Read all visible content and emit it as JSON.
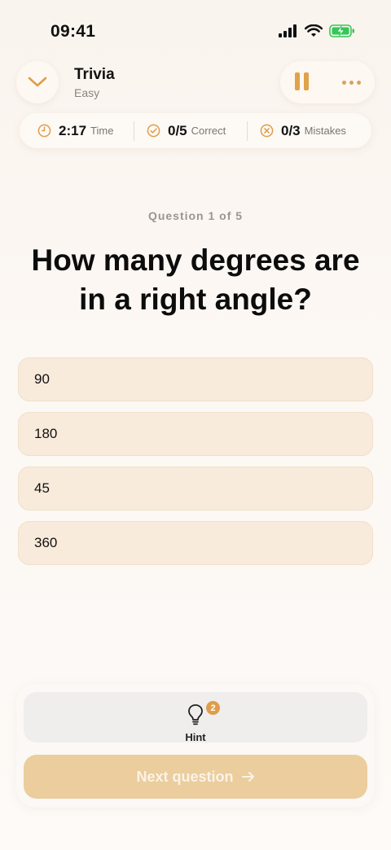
{
  "status_bar": {
    "time": "09:41",
    "battery_color": "#34c759"
  },
  "header": {
    "title": "Trivia",
    "subtitle": "Easy",
    "collapse_icon": "chevron-down-icon",
    "pause_icon": "pause-icon",
    "more_icon": "more-horizontal-icon",
    "accent_color": "#e0a24a"
  },
  "stats": {
    "time_value": "2:17",
    "time_label": "Time",
    "correct_value": "0/5",
    "correct_label": "Correct",
    "mistakes_value": "0/3",
    "mistakes_label": "Mistakes"
  },
  "question": {
    "progress": "Question 1 of 5",
    "text": "How many degrees are in a right angle?"
  },
  "answers": [
    "90",
    "180",
    "45",
    "360"
  ],
  "hint": {
    "label": "Hint",
    "count": "2",
    "icon": "lightbulb-icon"
  },
  "next": {
    "label": "Next question",
    "icon": "arrow-right-icon",
    "disabled": true
  }
}
